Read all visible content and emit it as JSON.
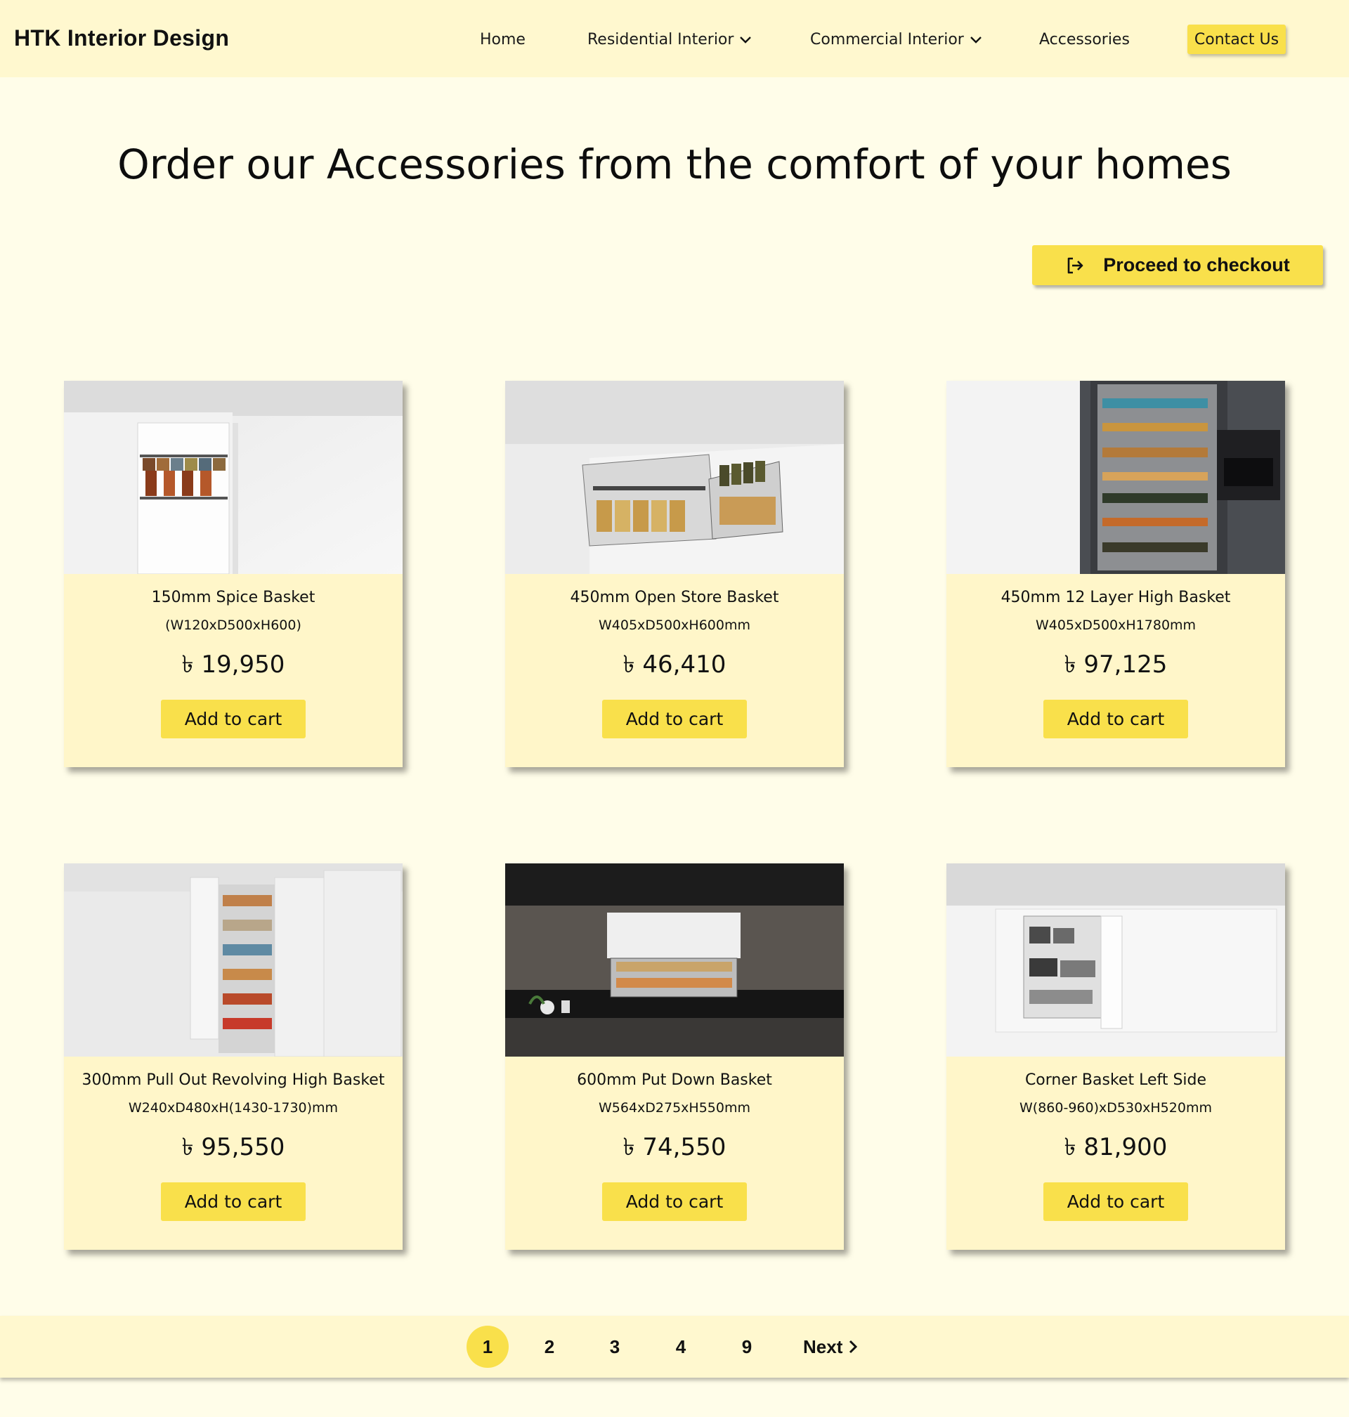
{
  "nav": {
    "brand": "HTK Interior Design",
    "items": [
      {
        "label": "Home"
      },
      {
        "label": "Residential Interior",
        "dropdown": true
      },
      {
        "label": "Commercial Interior",
        "dropdown": true
      },
      {
        "label": "Accessories"
      }
    ],
    "contact_label": "Contact Us"
  },
  "main": {
    "headline": "Order our Accessories from the comfort of your homes",
    "checkout_label": "Proceed to checkout"
  },
  "products": [
    {
      "name": "150mm Spice Basket",
      "dims": "(W120xD500xH600)",
      "price": "৳ 19,950",
      "add_label": "Add to cart"
    },
    {
      "name": "450mm Open Store Basket",
      "dims": "W405xD500xH600mm",
      "price": "৳ 46,410",
      "add_label": "Add to cart"
    },
    {
      "name": "450mm 12 Layer High Basket",
      "dims": "W405xD500xH1780mm",
      "price": "৳ 97,125",
      "add_label": "Add to cart"
    },
    {
      "name": "300mm Pull Out Revolving High Basket",
      "dims": "W240xD480xH(1430-1730)mm",
      "price": "৳ 95,550",
      "add_label": "Add to cart"
    },
    {
      "name": "600mm Put Down Basket",
      "dims": "W564xD275xH550mm",
      "price": "৳ 74,550",
      "add_label": "Add to cart"
    },
    {
      "name": "Corner Basket Left Side",
      "dims": "W(860-960)xD530xH520mm",
      "price": "৳ 81,900",
      "add_label": "Add to cart"
    }
  ],
  "pagination": {
    "pages": [
      "1",
      "2",
      "3",
      "4",
      "9"
    ],
    "active": "1",
    "next_label": "Next"
  },
  "colors": {
    "background": "#fffde9",
    "nav_background": "#fff8cf",
    "card_background": "#fff6c9",
    "accent": "#f9e04b"
  },
  "icons": {
    "checkout": "sign-out-arrow-icon",
    "dropdown": "chevron-down-icon",
    "next": "chevron-right-icon"
  }
}
